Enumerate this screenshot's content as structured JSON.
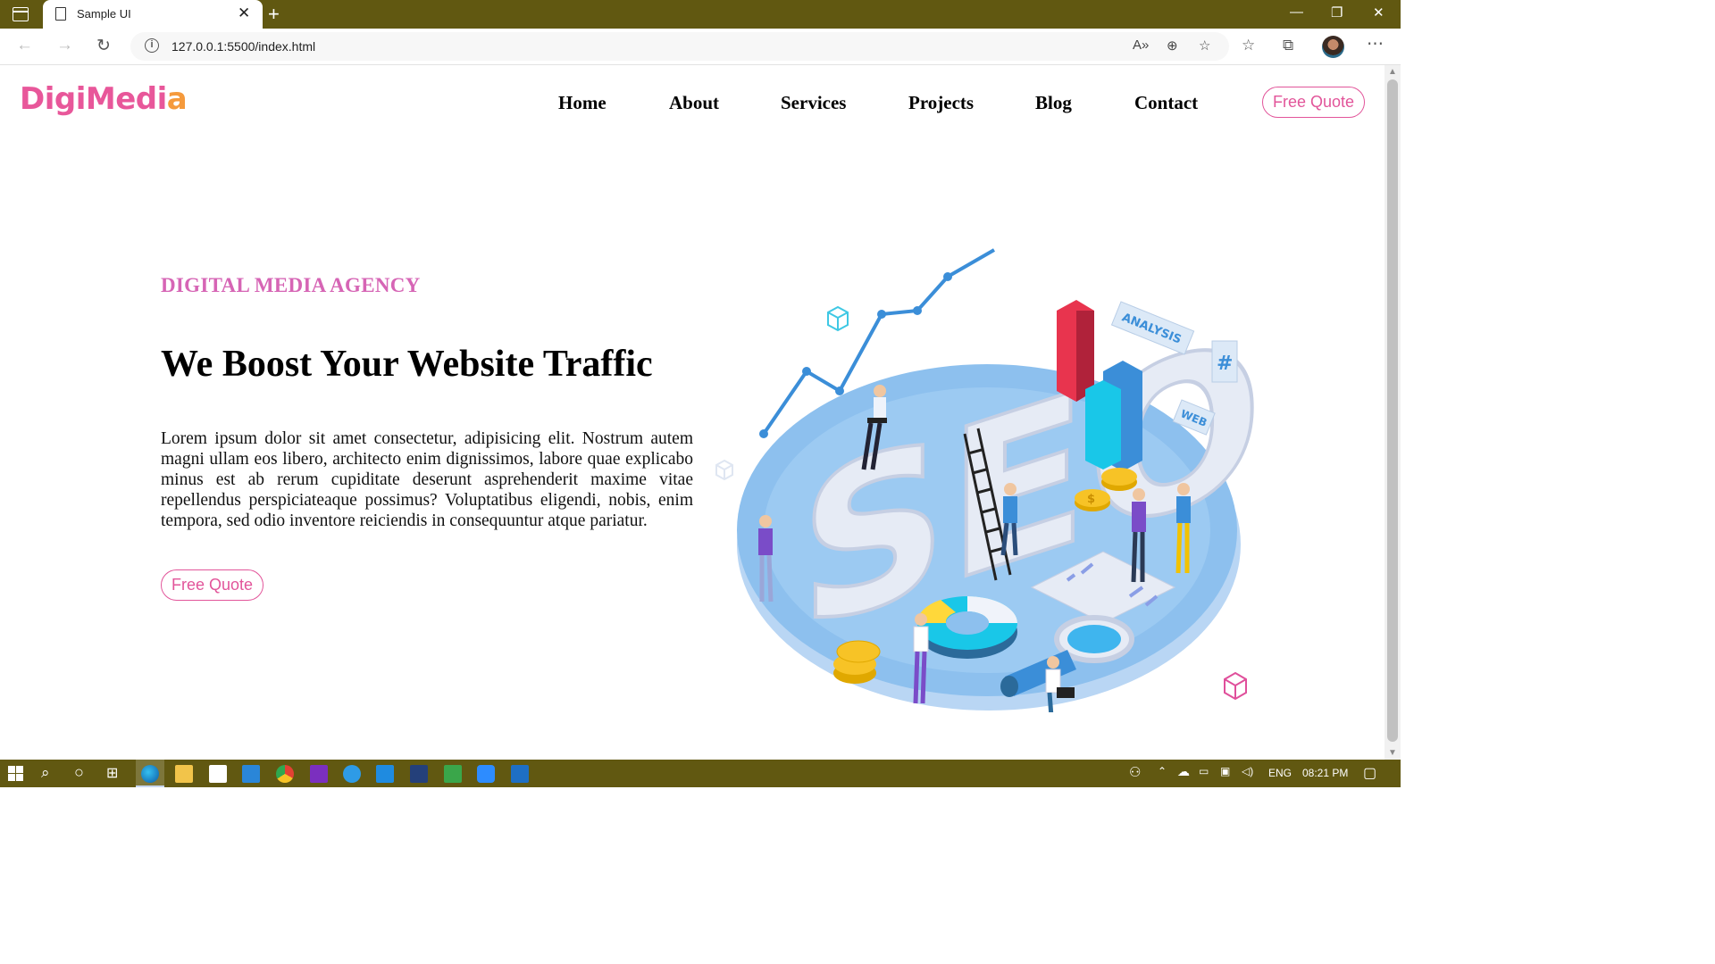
{
  "browser": {
    "tab_title": "Sample UI",
    "url": "127.0.0.1:5500/index.html"
  },
  "site": {
    "logo_main": "DigiMedi",
    "logo_accent": "a",
    "nav": [
      {
        "label": "Home"
      },
      {
        "label": "About"
      },
      {
        "label": "Services"
      },
      {
        "label": "Projects"
      },
      {
        "label": "Blog"
      },
      {
        "label": "Contact"
      }
    ],
    "header_button": "Free Quote"
  },
  "hero": {
    "kicker": "DIGITAL MEDIA AGENCY",
    "headline": "We Boost Your Website Traffic",
    "body": "Lorem ipsum dolor sit amet consectetur, adipisicing elit. Nostrum autem magni ullam eos libero, architecto enim dignissimos, labore quae explicabo minus est ab rerum cupiditate deserunt asprehenderit maxime vitae repellendus perspiciateaque possimus? Voluptatibus eligendi, nobis, enim tempora, sed odio inventore reiciendis in consequuntur atque pariatur.",
    "button": "Free Quote",
    "illustration": {
      "big_text": "SEO",
      "tag_analysis": "ANALYSIS",
      "tag_web": "WEB",
      "tag_hash": "#",
      "coin_symbol": "$"
    }
  },
  "taskbar": {
    "language": "ENG",
    "time": "08:21 PM"
  },
  "colors": {
    "titlebar": "#615811",
    "brand_pink": "#e8579a",
    "brand_orange": "#f59a3c",
    "kicker": "#d665b5"
  }
}
